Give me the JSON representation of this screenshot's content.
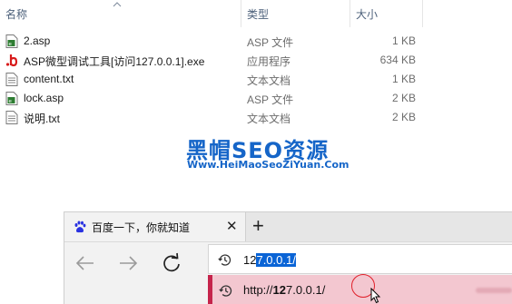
{
  "explorer": {
    "columns": {
      "name": "名称",
      "type": "类型",
      "size": "大小"
    },
    "files": [
      {
        "name": "2.asp",
        "type": "ASP 文件",
        "size": "1 KB",
        "icon": "asp-file-icon"
      },
      {
        "name": "ASP微型调试工具[访问127.0.0.1].exe",
        "type": "应用程序",
        "size": "634 KB",
        "icon": "exe-app-icon"
      },
      {
        "name": "content.txt",
        "type": "文本文档",
        "size": "1 KB",
        "icon": "text-file-icon"
      },
      {
        "name": "lock.asp",
        "type": "ASP 文件",
        "size": "2 KB",
        "icon": "asp-file-icon"
      },
      {
        "name": "说明.txt",
        "type": "文本文档",
        "size": "2 KB",
        "icon": "text-file-icon"
      }
    ]
  },
  "watermark": {
    "title": "黑帽SEO资源",
    "url": "Www.HeiMaoSeoZiYuan.Com"
  },
  "browser": {
    "tab_title": "百度一下，你就知道",
    "tab_close": "✕",
    "new_tab": "+",
    "address": {
      "prefix": "12",
      "selected": "7.0.0.1/"
    },
    "suggestion": {
      "scheme": "http://",
      "bold": "12",
      "rest": "7.0.0.1/"
    }
  },
  "colors": {
    "watermark": "#1565c8",
    "address_selection": "#0a64d6",
    "suggestion_bg": "#f3c7d0",
    "suggestion_accent": "#c5244b",
    "highlight_circle": "#e0202a"
  }
}
